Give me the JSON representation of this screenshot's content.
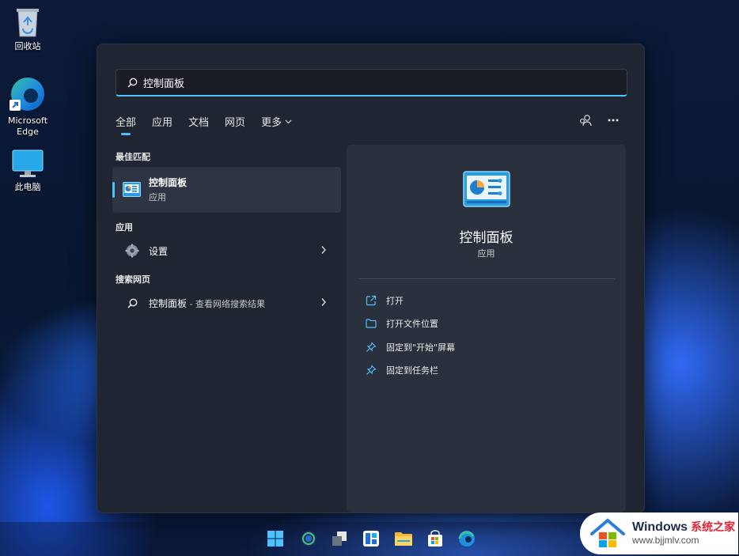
{
  "desktop": {
    "icons": [
      {
        "label": "回收站",
        "icon": "recycle-bin-icon"
      },
      {
        "label": "Microsoft\nEdge",
        "icon": "edge-icon"
      },
      {
        "label": "此电脑",
        "icon": "monitor-icon"
      }
    ]
  },
  "search": {
    "value": "控制面板"
  },
  "tabs": [
    {
      "label": "全部",
      "active": true
    },
    {
      "label": "应用"
    },
    {
      "label": "文档"
    },
    {
      "label": "网页"
    },
    {
      "label": "更多"
    }
  ],
  "results": {
    "best_match_heading": "最佳匹配",
    "best_match": {
      "name": "控制面板",
      "type": "应用"
    },
    "apps_heading": "应用",
    "apps": [
      {
        "name": "设置"
      }
    ],
    "web_heading": "搜索网页",
    "web": [
      {
        "name": "控制面板",
        "desc": " - 查看网络搜索结果"
      }
    ]
  },
  "preview": {
    "title": "控制面板",
    "subtitle": "应用",
    "actions": [
      {
        "label": "打开",
        "icon": "open-external-icon"
      },
      {
        "label": "打开文件位置",
        "icon": "folder-icon"
      },
      {
        "label": "固定到\"开始\"屏幕",
        "icon": "pin-icon"
      },
      {
        "label": "固定到任务栏",
        "icon": "pin-icon"
      }
    ]
  },
  "taskbar": {
    "icons": [
      "windows-start-icon",
      "search-icon",
      "task-view-icon",
      "widgets-icon",
      "file-explorer-icon",
      "store-icon",
      "edge-icon"
    ]
  },
  "watermark": {
    "brand": "Windows",
    "cn": "系统之家",
    "url": "www.bjjmlv.com"
  },
  "colors": {
    "accent": "#4cc2ff",
    "panel": "#1f2531",
    "preview_panel": "#2a303c"
  }
}
